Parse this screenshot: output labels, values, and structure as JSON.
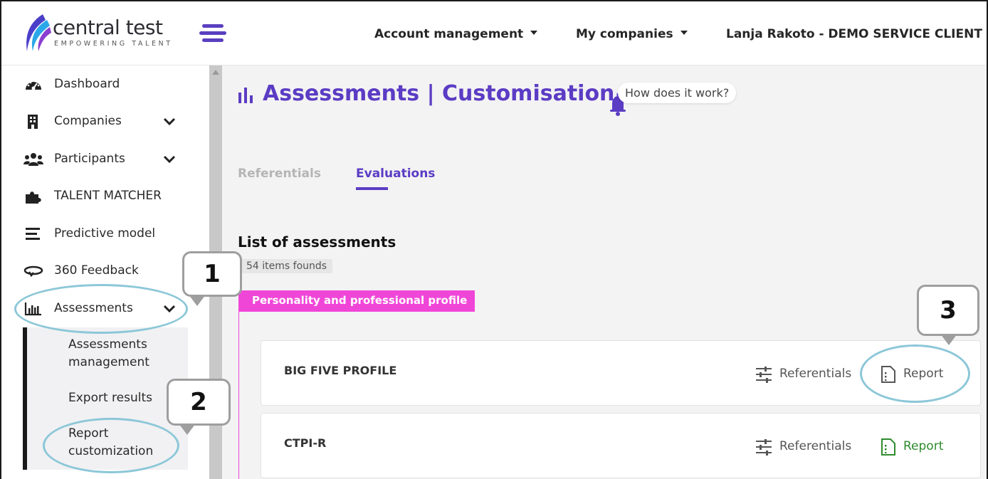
{
  "brand": {
    "name": "central test",
    "tagline": "EMPOWERING TALENT",
    "accent": "#5b3cc4"
  },
  "header": {
    "menu_icon": "hamburger-icon",
    "nav": [
      {
        "label": "Account management"
      },
      {
        "label": "My companies"
      },
      {
        "label": "Lanja Rakoto - DEMO SERVICE CLIENT"
      }
    ]
  },
  "sidebar": {
    "items": [
      {
        "label": "Dashboard",
        "icon": "dashboard-gauge-icon"
      },
      {
        "label": "Companies",
        "icon": "building-icon"
      },
      {
        "label": "Participants",
        "icon": "users-icon"
      },
      {
        "label": "TALENT MATCHER",
        "icon": "puzzle-icon"
      },
      {
        "label": "Predictive model",
        "icon": "bars-icon"
      },
      {
        "label": "360 Feedback",
        "icon": "rotate-icon"
      },
      {
        "label": "Assessments",
        "icon": "chart-icon"
      }
    ],
    "submenu": [
      {
        "label": "Assessments\nmanagement"
      },
      {
        "label": "Export results"
      },
      {
        "label": "Report\ncustomization"
      }
    ]
  },
  "main": {
    "title": "Assessments | Customisation",
    "help_label": "How does it work?",
    "tabs": [
      {
        "label": "Referentials",
        "active": false
      },
      {
        "label": "Evaluations",
        "active": true
      }
    ],
    "list_title": "List of assessments",
    "count_label": "54 items founds",
    "category": {
      "label": "Personality and professional profile",
      "color": "#f046d8"
    },
    "rows": [
      {
        "name": "BIG FIVE PROFILE",
        "referentials_label": "Referentials",
        "report_label": "Report",
        "report_color": "#555555"
      },
      {
        "name": "CTPI-R",
        "referentials_label": "Referentials",
        "report_label": "Report",
        "report_color": "#2e8b2e"
      }
    ]
  },
  "annotations": {
    "callouts": [
      "1",
      "2",
      "3"
    ],
    "ellipse_color": "#8cc7d8"
  }
}
